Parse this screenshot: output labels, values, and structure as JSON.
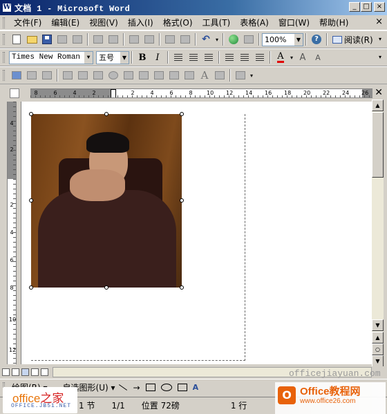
{
  "window": {
    "app_icon": "W",
    "title": "文档 1 - Microsoft Word",
    "minimize": "_",
    "maximize": "□",
    "close": "×"
  },
  "menubar": {
    "items": [
      "文件(F)",
      "编辑(E)",
      "视图(V)",
      "插入(I)",
      "格式(O)",
      "工具(T)",
      "表格(A)",
      "窗口(W)",
      "帮助(H)"
    ],
    "doc_close": "×"
  },
  "toolbar_standard": {
    "zoom": "100%",
    "read_label": "阅读(R)"
  },
  "toolbar_formatting": {
    "font_name": "Times New Roman",
    "font_size": "五号",
    "bold": "B",
    "italic": "I",
    "font_color_letter": "A"
  },
  "ruler": {
    "horizontal_numbers": [
      "8",
      "6",
      "4",
      "2",
      "2",
      "4",
      "6",
      "8",
      "10",
      "12",
      "14",
      "16",
      "18",
      "20",
      "22",
      "24",
      "26"
    ],
    "vertical_numbers": [
      "4",
      "2",
      "2",
      "4",
      "6",
      "8",
      "10",
      "12"
    ]
  },
  "drawing_toolbar": {
    "draw_label": "绘图(R) ▾",
    "autoshapes_label": "自选图形(U) ▾"
  },
  "statusbar": {
    "section": "1 节",
    "page": "1/1",
    "position": "位置 72磅",
    "line": "1 行"
  },
  "watermarks": {
    "left_brand": "office之家",
    "left_brand_part1": "office",
    "left_brand_part2": "之家",
    "left_sub": "OFFICE.JB51.NET",
    "center_url": "officejiayuan.com",
    "right_brand_part1": "Office",
    "right_brand_part2": "教程网",
    "right_url": "www.office26.com"
  },
  "icons": [
    "document-icon",
    "new-document-icon",
    "open-folder-icon",
    "save-icon",
    "print-icon",
    "undo-icon",
    "hyperlink-globe-icon",
    "help-icon",
    "read-mode-icon",
    "bold-icon",
    "italic-icon",
    "font-color-icon"
  ],
  "colors": {
    "titlebar_start": "#0a246a",
    "titlebar_end": "#a6caf0",
    "font_color_bar": "#e00000"
  }
}
